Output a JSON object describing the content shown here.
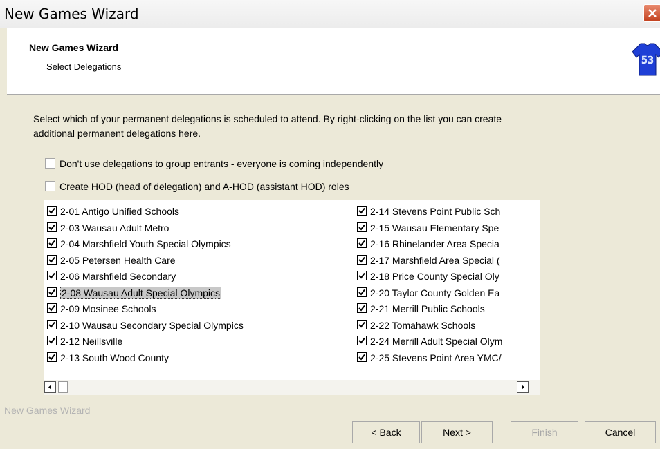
{
  "window": {
    "title": "New Games Wizard"
  },
  "header": {
    "title": "New Games Wizard",
    "subtitle": "Select Delegations",
    "logo_number": "53"
  },
  "instructions": "Select which of your permanent delegations is scheduled to attend. By right-clicking on the list you can create additional permanent delegations here.",
  "options": [
    {
      "label": "Don't use delegations to group entrants - everyone is coming independently",
      "checked": false
    },
    {
      "label": "Create HOD (head of delegation) and A-HOD (assistant HOD) roles",
      "checked": false
    }
  ],
  "delegations_col1": [
    {
      "label": "2-01 Antigo Unified Schools",
      "checked": true
    },
    {
      "label": "2-03 Wausau Adult Metro",
      "checked": true
    },
    {
      "label": "2-04 Marshfield Youth Special Olympics",
      "checked": true
    },
    {
      "label": "2-05 Petersen Health Care",
      "checked": true
    },
    {
      "label": "2-06 Marshfield Secondary",
      "checked": true
    },
    {
      "label": "2-08 Wausau Adult Special Olympics",
      "checked": true,
      "selected": true
    },
    {
      "label": "2-09 Mosinee Schools",
      "checked": true
    },
    {
      "label": "2-10 Wausau Secondary Special Olympics",
      "checked": true
    },
    {
      "label": "2-12 Neillsville",
      "checked": true
    },
    {
      "label": "2-13 South Wood County",
      "checked": true
    }
  ],
  "delegations_col2": [
    {
      "label": "2-14 Stevens Point Public Sch",
      "checked": true
    },
    {
      "label": "2-15 Wausau Elementary Spe",
      "checked": true
    },
    {
      "label": "2-16 Rhinelander Area Specia",
      "checked": true
    },
    {
      "label": "2-17 Marshfield Area Special (",
      "checked": true
    },
    {
      "label": "2-18 Price County Special Oly",
      "checked": true
    },
    {
      "label": "2-20 Taylor County Golden Ea",
      "checked": true
    },
    {
      "label": "2-21 Merrill Public Schools",
      "checked": true
    },
    {
      "label": "2-22 Tomahawk Schools",
      "checked": true
    },
    {
      "label": "2-24 Merrill Adult Special Olym",
      "checked": true
    },
    {
      "label": "2-25 Stevens Point Area YMC/",
      "checked": true
    }
  ],
  "group_label": "New Games Wizard",
  "buttons": {
    "back": "< Back",
    "next": "Next >",
    "finish": "Finish",
    "cancel": "Cancel"
  },
  "colors": {
    "jersey": "#1f3fd6",
    "close": "#d05a34"
  }
}
